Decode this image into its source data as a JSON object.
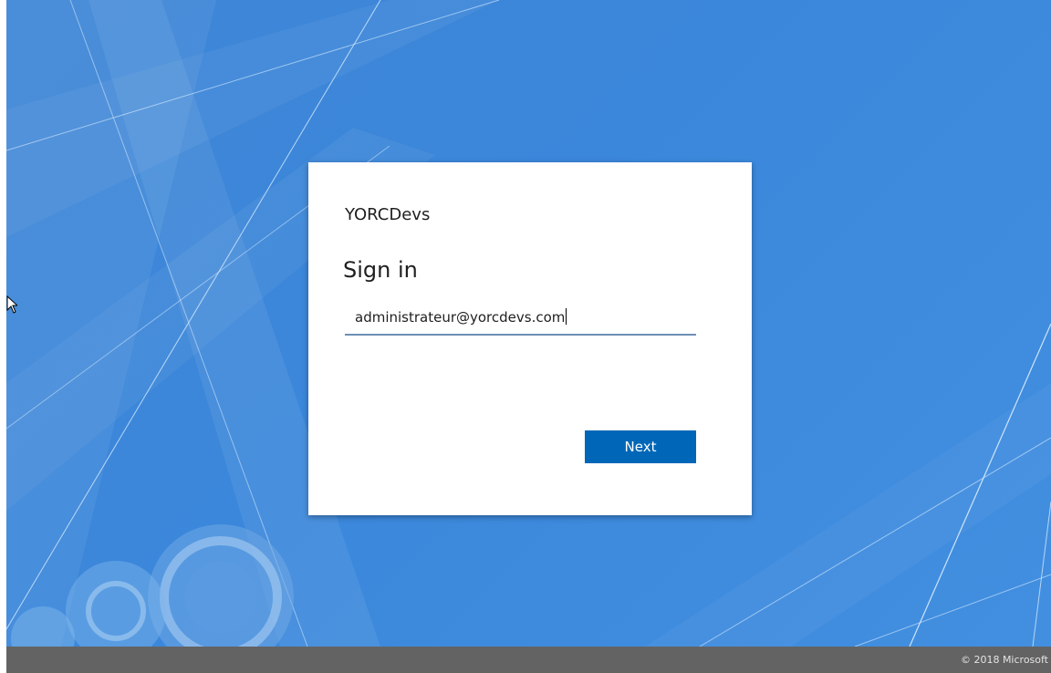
{
  "signin": {
    "organization": "YORCDevs",
    "heading": "Sign in",
    "email_value": "administrateur@yorcdevs.com",
    "next_label": "Next"
  },
  "footer": {
    "copyright": "© 2018 Microsoft"
  },
  "colors": {
    "wallpaper": "#3b87db",
    "button": "#0067b8",
    "footer": "#636363"
  },
  "icons": {
    "cursor": "mouse-pointer-icon"
  }
}
